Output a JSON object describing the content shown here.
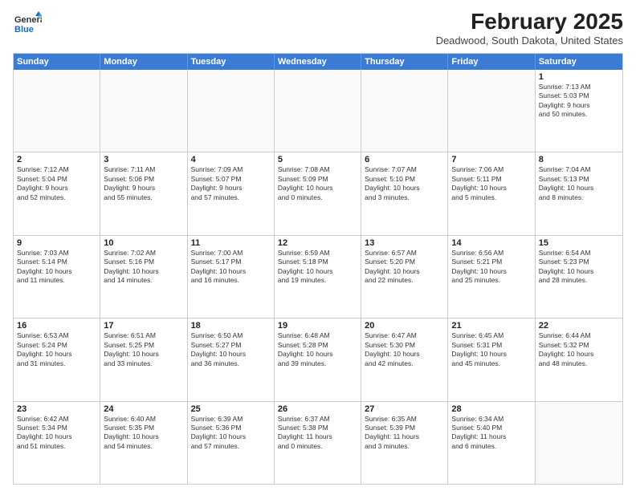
{
  "logo": {
    "general": "General",
    "blue": "Blue"
  },
  "header": {
    "title": "February 2025",
    "subtitle": "Deadwood, South Dakota, United States"
  },
  "days_of_week": [
    "Sunday",
    "Monday",
    "Tuesday",
    "Wednesday",
    "Thursday",
    "Friday",
    "Saturday"
  ],
  "weeks": [
    [
      {
        "day": "",
        "info": ""
      },
      {
        "day": "",
        "info": ""
      },
      {
        "day": "",
        "info": ""
      },
      {
        "day": "",
        "info": ""
      },
      {
        "day": "",
        "info": ""
      },
      {
        "day": "",
        "info": ""
      },
      {
        "day": "1",
        "info": "Sunrise: 7:13 AM\nSunset: 5:03 PM\nDaylight: 9 hours\nand 50 minutes."
      }
    ],
    [
      {
        "day": "2",
        "info": "Sunrise: 7:12 AM\nSunset: 5:04 PM\nDaylight: 9 hours\nand 52 minutes."
      },
      {
        "day": "3",
        "info": "Sunrise: 7:11 AM\nSunset: 5:06 PM\nDaylight: 9 hours\nand 55 minutes."
      },
      {
        "day": "4",
        "info": "Sunrise: 7:09 AM\nSunset: 5:07 PM\nDaylight: 9 hours\nand 57 minutes."
      },
      {
        "day": "5",
        "info": "Sunrise: 7:08 AM\nSunset: 5:09 PM\nDaylight: 10 hours\nand 0 minutes."
      },
      {
        "day": "6",
        "info": "Sunrise: 7:07 AM\nSunset: 5:10 PM\nDaylight: 10 hours\nand 3 minutes."
      },
      {
        "day": "7",
        "info": "Sunrise: 7:06 AM\nSunset: 5:11 PM\nDaylight: 10 hours\nand 5 minutes."
      },
      {
        "day": "8",
        "info": "Sunrise: 7:04 AM\nSunset: 5:13 PM\nDaylight: 10 hours\nand 8 minutes."
      }
    ],
    [
      {
        "day": "9",
        "info": "Sunrise: 7:03 AM\nSunset: 5:14 PM\nDaylight: 10 hours\nand 11 minutes."
      },
      {
        "day": "10",
        "info": "Sunrise: 7:02 AM\nSunset: 5:16 PM\nDaylight: 10 hours\nand 14 minutes."
      },
      {
        "day": "11",
        "info": "Sunrise: 7:00 AM\nSunset: 5:17 PM\nDaylight: 10 hours\nand 16 minutes."
      },
      {
        "day": "12",
        "info": "Sunrise: 6:59 AM\nSunset: 5:18 PM\nDaylight: 10 hours\nand 19 minutes."
      },
      {
        "day": "13",
        "info": "Sunrise: 6:57 AM\nSunset: 5:20 PM\nDaylight: 10 hours\nand 22 minutes."
      },
      {
        "day": "14",
        "info": "Sunrise: 6:56 AM\nSunset: 5:21 PM\nDaylight: 10 hours\nand 25 minutes."
      },
      {
        "day": "15",
        "info": "Sunrise: 6:54 AM\nSunset: 5:23 PM\nDaylight: 10 hours\nand 28 minutes."
      }
    ],
    [
      {
        "day": "16",
        "info": "Sunrise: 6:53 AM\nSunset: 5:24 PM\nDaylight: 10 hours\nand 31 minutes."
      },
      {
        "day": "17",
        "info": "Sunrise: 6:51 AM\nSunset: 5:25 PM\nDaylight: 10 hours\nand 33 minutes."
      },
      {
        "day": "18",
        "info": "Sunrise: 6:50 AM\nSunset: 5:27 PM\nDaylight: 10 hours\nand 36 minutes."
      },
      {
        "day": "19",
        "info": "Sunrise: 6:48 AM\nSunset: 5:28 PM\nDaylight: 10 hours\nand 39 minutes."
      },
      {
        "day": "20",
        "info": "Sunrise: 6:47 AM\nSunset: 5:30 PM\nDaylight: 10 hours\nand 42 minutes."
      },
      {
        "day": "21",
        "info": "Sunrise: 6:45 AM\nSunset: 5:31 PM\nDaylight: 10 hours\nand 45 minutes."
      },
      {
        "day": "22",
        "info": "Sunrise: 6:44 AM\nSunset: 5:32 PM\nDaylight: 10 hours\nand 48 minutes."
      }
    ],
    [
      {
        "day": "23",
        "info": "Sunrise: 6:42 AM\nSunset: 5:34 PM\nDaylight: 10 hours\nand 51 minutes."
      },
      {
        "day": "24",
        "info": "Sunrise: 6:40 AM\nSunset: 5:35 PM\nDaylight: 10 hours\nand 54 minutes."
      },
      {
        "day": "25",
        "info": "Sunrise: 6:39 AM\nSunset: 5:36 PM\nDaylight: 10 hours\nand 57 minutes."
      },
      {
        "day": "26",
        "info": "Sunrise: 6:37 AM\nSunset: 5:38 PM\nDaylight: 11 hours\nand 0 minutes."
      },
      {
        "day": "27",
        "info": "Sunrise: 6:35 AM\nSunset: 5:39 PM\nDaylight: 11 hours\nand 3 minutes."
      },
      {
        "day": "28",
        "info": "Sunrise: 6:34 AM\nSunset: 5:40 PM\nDaylight: 11 hours\nand 6 minutes."
      },
      {
        "day": "",
        "info": ""
      }
    ]
  ]
}
